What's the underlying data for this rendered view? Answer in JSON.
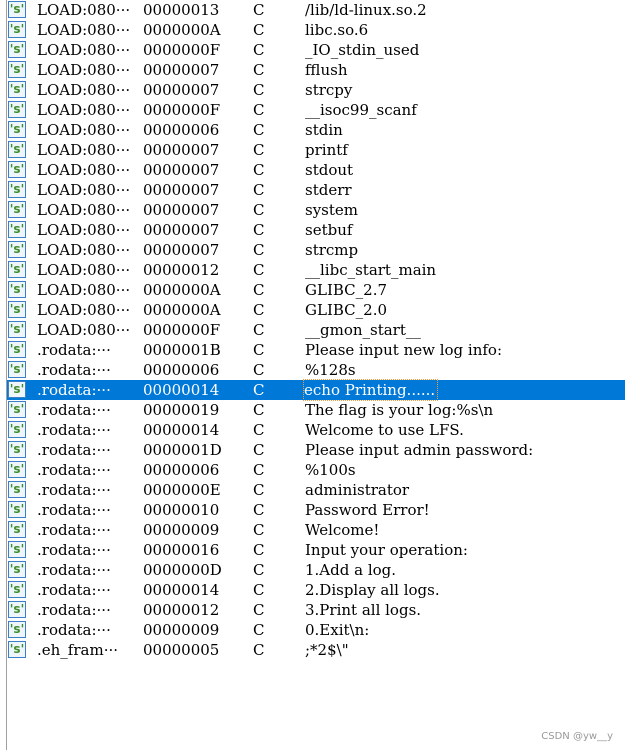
{
  "selected_index": 19,
  "icon": "string-s-icon",
  "rows": [
    {
      "address": "LOAD:080···",
      "length": "00000013",
      "type": "C",
      "string": "/lib/ld-linux.so.2"
    },
    {
      "address": "LOAD:080···",
      "length": "0000000A",
      "type": "C",
      "string": "libc.so.6"
    },
    {
      "address": "LOAD:080···",
      "length": "0000000F",
      "type": "C",
      "string": "_IO_stdin_used"
    },
    {
      "address": "LOAD:080···",
      "length": "00000007",
      "type": "C",
      "string": "fflush"
    },
    {
      "address": "LOAD:080···",
      "length": "00000007",
      "type": "C",
      "string": "strcpy"
    },
    {
      "address": "LOAD:080···",
      "length": "0000000F",
      "type": "C",
      "string": "__isoc99_scanf"
    },
    {
      "address": "LOAD:080···",
      "length": "00000006",
      "type": "C",
      "string": "stdin"
    },
    {
      "address": "LOAD:080···",
      "length": "00000007",
      "type": "C",
      "string": "printf"
    },
    {
      "address": "LOAD:080···",
      "length": "00000007",
      "type": "C",
      "string": "stdout"
    },
    {
      "address": "LOAD:080···",
      "length": "00000007",
      "type": "C",
      "string": "stderr"
    },
    {
      "address": "LOAD:080···",
      "length": "00000007",
      "type": "C",
      "string": "system"
    },
    {
      "address": "LOAD:080···",
      "length": "00000007",
      "type": "C",
      "string": "setbuf"
    },
    {
      "address": "LOAD:080···",
      "length": "00000007",
      "type": "C",
      "string": "strcmp"
    },
    {
      "address": "LOAD:080···",
      "length": "00000012",
      "type": "C",
      "string": "__libc_start_main"
    },
    {
      "address": "LOAD:080···",
      "length": "0000000A",
      "type": "C",
      "string": "GLIBC_2.7"
    },
    {
      "address": "LOAD:080···",
      "length": "0000000A",
      "type": "C",
      "string": "GLIBC_2.0"
    },
    {
      "address": "LOAD:080···",
      "length": "0000000F",
      "type": "C",
      "string": "__gmon_start__"
    },
    {
      "address": ".rodata:···",
      "length": "0000001B",
      "type": "C",
      "string": "Please input new log info:"
    },
    {
      "address": ".rodata:···",
      "length": "00000006",
      "type": "C",
      "string": "%128s"
    },
    {
      "address": ".rodata:···",
      "length": "00000014",
      "type": "C",
      "string": "echo Printing......"
    },
    {
      "address": ".rodata:···",
      "length": "00000019",
      "type": "C",
      "string": "The flag is your log:%s\\n"
    },
    {
      "address": ".rodata:···",
      "length": "00000014",
      "type": "C",
      "string": "Welcome to use LFS."
    },
    {
      "address": ".rodata:···",
      "length": "0000001D",
      "type": "C",
      "string": "Please input admin password:"
    },
    {
      "address": ".rodata:···",
      "length": "00000006",
      "type": "C",
      "string": "%100s"
    },
    {
      "address": ".rodata:···",
      "length": "0000000E",
      "type": "C",
      "string": "administrator"
    },
    {
      "address": ".rodata:···",
      "length": "00000010",
      "type": "C",
      "string": "Password Error!"
    },
    {
      "address": ".rodata:···",
      "length": "00000009",
      "type": "C",
      "string": "Welcome!"
    },
    {
      "address": ".rodata:···",
      "length": "00000016",
      "type": "C",
      "string": "Input your operation:"
    },
    {
      "address": ".rodata:···",
      "length": "0000000D",
      "type": "C",
      "string": "1.Add a log."
    },
    {
      "address": ".rodata:···",
      "length": "00000014",
      "type": "C",
      "string": "2.Display all logs."
    },
    {
      "address": ".rodata:···",
      "length": "00000012",
      "type": "C",
      "string": "3.Print all logs."
    },
    {
      "address": ".rodata:···",
      "length": "00000009",
      "type": "C",
      "string": "0.Exit\\n:"
    },
    {
      "address": ".eh_fram···",
      "length": "00000005",
      "type": "C",
      "string": ";*2$\\\""
    }
  ],
  "icon_glyph": "'s'",
  "watermark": "CSDN @yw__y",
  "colors": {
    "selection": "#0078d7",
    "icon_green": "#3e8f2a",
    "icon_border": "#3a7fc8"
  }
}
